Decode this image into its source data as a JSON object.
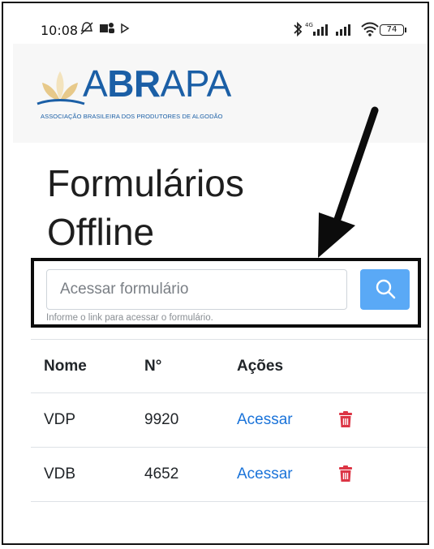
{
  "status_bar": {
    "time": "10:08",
    "battery": "74",
    "network": "4G"
  },
  "header": {
    "logo_text_prefix": "A",
    "logo_text_bold": "BR",
    "logo_text_suffix": "APA",
    "logo_subtitle": "ASSOCIAÇÃO BRASILEIRA DOS PRODUTORES DE ALGODÃO"
  },
  "page": {
    "title": "Formulários Offline"
  },
  "search": {
    "placeholder": "Acessar formulário",
    "help": "Informe o link para acessar o formulário.",
    "button_icon": "search-icon"
  },
  "table": {
    "headers": [
      "Nome",
      "N°",
      "Ações"
    ],
    "rows": [
      {
        "nome": "VDP",
        "numero": "9920",
        "acao": "Acessar"
      },
      {
        "nome": "VDB",
        "numero": "4652",
        "acao": "Acessar"
      }
    ]
  },
  "colors": {
    "brand": "#1b5fa6",
    "primary_button": "#5aa9f6",
    "link": "#1a73d9",
    "delete": "#dc3545"
  },
  "icons": {
    "delete": "trash-icon",
    "annotation": "arrow-icon"
  }
}
